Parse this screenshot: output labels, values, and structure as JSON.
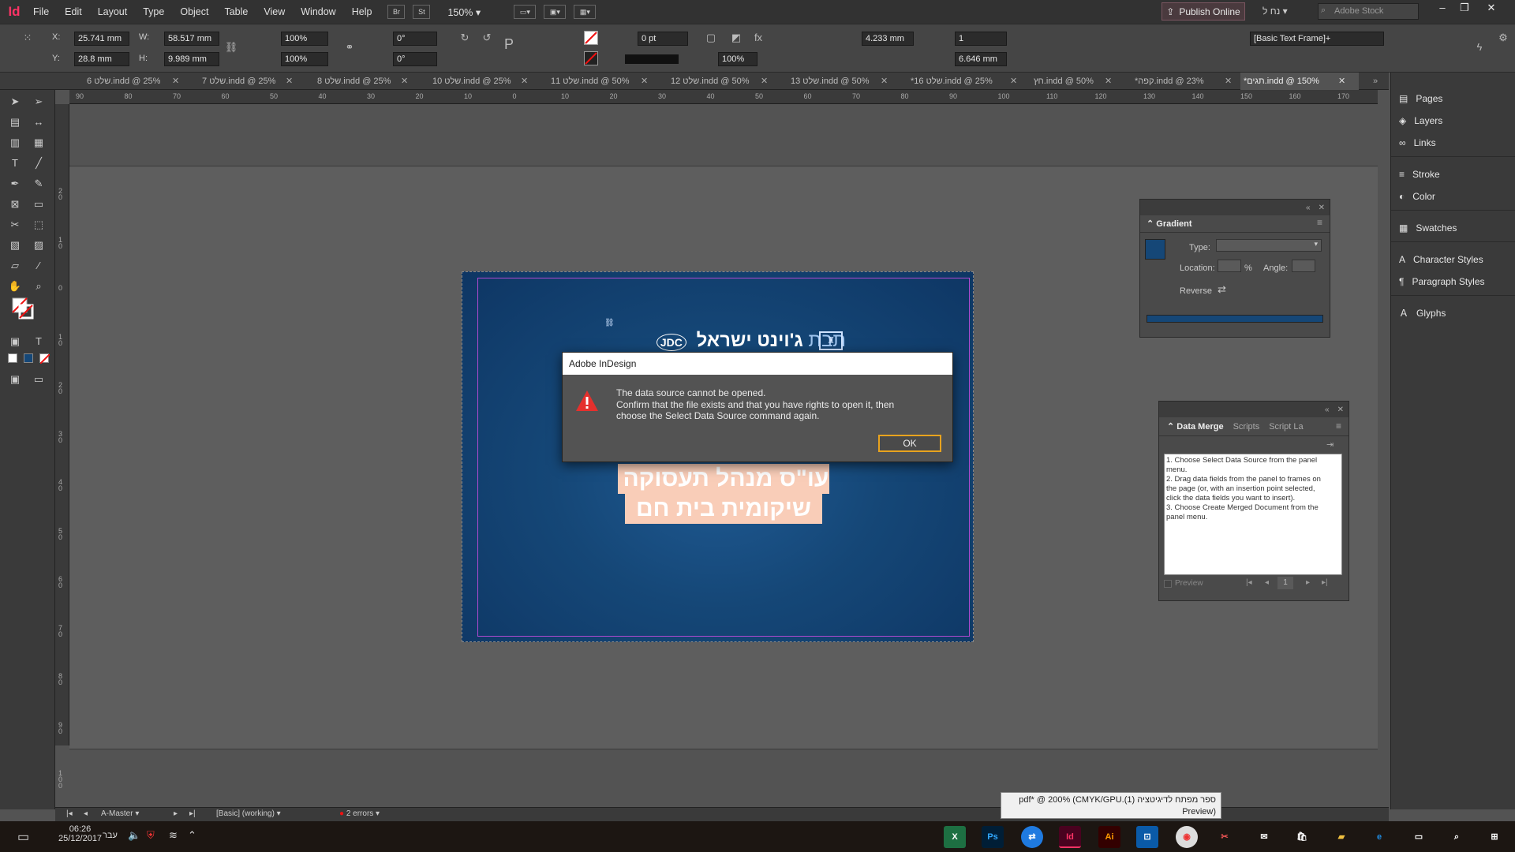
{
  "menubar": {
    "logo": "Id",
    "items": [
      "File",
      "Edit",
      "Layout",
      "Type",
      "Object",
      "Table",
      "View",
      "Window",
      "Help"
    ],
    "bridge_label": "Br",
    "stock_label": "St",
    "zoom": "150%",
    "publish_label": "Publish Online",
    "user_label": "נח ל",
    "search_placeholder": "Adobe Stock"
  },
  "control": {
    "x": "25.741 mm",
    "y": "28.8 mm",
    "w": "58.517 mm",
    "h": "9.989 mm",
    "scale_x": "100%",
    "scale_y": "100%",
    "rotate": "0°",
    "shear": "0°",
    "stroke_weight": "0 pt",
    "opacity": "100%",
    "gutter": "4.233 mm",
    "columns": "1",
    "inset": "6.646 mm",
    "style": "[Basic Text Frame]+"
  },
  "tabs": [
    {
      "label": "6 שלט.indd @ 25%"
    },
    {
      "label": "7 שלט.indd @ 25%"
    },
    {
      "label": "8 שלט.indd @ 25%"
    },
    {
      "label": "10 שלט.indd @ 25%"
    },
    {
      "label": "11 שלט.indd @ 50%"
    },
    {
      "label": "12 שלט.indd @ 50%"
    },
    {
      "label": "13 שלט.indd @ 50%"
    },
    {
      "label": "*16 שלט.indd @ 25%"
    },
    {
      "label": "חץ.indd @ 50%"
    },
    {
      "label": "*קפה.indd @ 23%"
    },
    {
      "label": "*תגים.indd @ 150%"
    }
  ],
  "ruler_h": [
    "90",
    "80",
    "70",
    "60",
    "50",
    "40",
    "30",
    "20",
    "10",
    "0",
    "10",
    "20",
    "30",
    "40",
    "50",
    "60",
    "70",
    "80",
    "90",
    "100",
    "110",
    "120",
    "130",
    "140",
    "150",
    "160",
    "170"
  ],
  "ruler_v": [
    "2 0",
    "1 0",
    "0",
    "1 0",
    "2 0",
    "3 0",
    "4 0",
    "5 0",
    "6 0",
    "7 0",
    "8 0",
    "9 0",
    "1 0 0"
  ],
  "document": {
    "logo_text": "ג'וינט ישראל",
    "logo_extra": "תבת",
    "logo_mark": "JDC",
    "line1": "עו\"ס מנהל תעסוקה",
    "line2": "שיקומית בית חם"
  },
  "dialog": {
    "title": "Adobe InDesign",
    "line1": "The data source cannot be opened.",
    "line2": "Confirm that the file exists and that you have rights to open it, then",
    "line3": "choose the Select Data Source command again.",
    "ok_label": "OK"
  },
  "gradient_panel": {
    "title": "Gradient",
    "type_label": "Type:",
    "location_label": "Location:",
    "percent": "%",
    "angle_label": "Angle:",
    "reverse_label": "Reverse"
  },
  "datamerge_panel": {
    "tab_active": "Data Merge",
    "tab2": "Scripts",
    "tab3": "Script La",
    "instructions": "1. Choose Select Data Source from the panel menu.\n2. Drag data fields from the panel to frames on the page (or, with an insertion point selected, click the data fields you want to insert).\n3. Choose Create Merged Document from the panel menu.",
    "preview_label": "Preview",
    "record": "1"
  },
  "dock": [
    {
      "label": "Pages",
      "icon": "pages-icon",
      "glyph": "▤"
    },
    {
      "label": "Layers",
      "icon": "layers-icon",
      "glyph": "◈"
    },
    {
      "label": "Links",
      "icon": "links-icon",
      "glyph": "∞"
    },
    {
      "label": "Stroke",
      "icon": "stroke-icon",
      "glyph": "≡"
    },
    {
      "label": "Color",
      "icon": "color-icon",
      "glyph": "◐"
    },
    {
      "label": "Swatches",
      "icon": "swatches-icon",
      "glyph": "▦"
    },
    {
      "label": "Character Styles",
      "icon": "character-styles-icon",
      "glyph": "A"
    },
    {
      "label": "Paragraph Styles",
      "icon": "paragraph-styles-icon",
      "glyph": "¶"
    },
    {
      "label": "Glyphs",
      "icon": "glyphs-icon",
      "glyph": "Ａ"
    }
  ],
  "status": {
    "page": "A-Master",
    "profile": "[Basic] (working)",
    "errors": "2 errors"
  },
  "tooltip": {
    "line1": "ספר מפתח לדיגיטציה (1).pdf* @ 200% (CMYK/GPU",
    "line2": "(Preview"
  },
  "taskbar": {
    "time": "06:26",
    "date": "25/12/2017",
    "lang": "עבר"
  },
  "colors": {
    "indesign": "#ff3366",
    "dialog_ok_border": "#e8a31e",
    "page_blue": "#154777",
    "text_highlight": "#f9cdb8",
    "warning_red": "#e5302d"
  }
}
